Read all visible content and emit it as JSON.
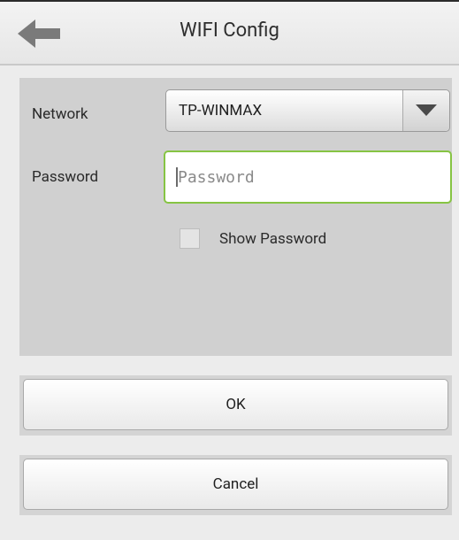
{
  "header": {
    "title": "WIFI Config",
    "back_icon": "left-arrow-icon"
  },
  "form": {
    "network_label": "Network",
    "network_value": "TP-WINMAX",
    "dropdown_icon": "triangle-down-icon",
    "password_label": "Password",
    "password_placeholder": "Password",
    "password_value": "",
    "show_password_label": "Show Password",
    "show_password_checked": false
  },
  "actions": {
    "ok_label": "OK",
    "cancel_label": "Cancel"
  },
  "colors": {
    "focus_border": "#86c443",
    "panel_bg": "#d0d0d0",
    "page_bg": "#ececec"
  }
}
